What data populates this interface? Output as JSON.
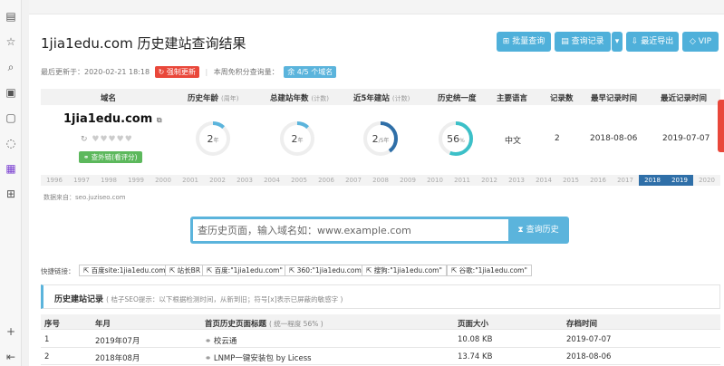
{
  "title": "1jia1edu.com 历史建站查询结果",
  "toolbar": {
    "batch": "批量查询",
    "records": "查询记录",
    "export": "最近导出",
    "vip": "VIP"
  },
  "meta": {
    "updated_prefix": "最后更新于：",
    "updated_time": "2020-02-21 18:18",
    "force_update": "强制更新",
    "weekly_prefix": "本周免积分查询量：",
    "weekly_badge": "余 4/5 个域名"
  },
  "columns": {
    "domain": "域名",
    "age": "历史年龄",
    "age_unit": "(周年)",
    "total": "总建站年数",
    "total_unit": "(计数)",
    "recent": "近5年建站",
    "recent_unit": "(计数)",
    "unity": "历史统一度",
    "lang": "主要语言",
    "count": "记录数",
    "earliest": "最早记录时间",
    "latest": "最近记录时间"
  },
  "summary": {
    "domain": "1jia1edu.com",
    "hearts": "♥♥♥♥♥",
    "outlink": "查外链(看评分)",
    "age_value": "2",
    "age_unit": "年",
    "age_fraction": 0.12,
    "total_value": "2",
    "total_unit": "年",
    "total_fraction": 0.12,
    "recent_value": "2",
    "recent_unit": "/5年",
    "recent_fraction": 0.4,
    "unity_value": "56",
    "unity_unit": "%",
    "unity_fraction": 0.56,
    "lang": "中文",
    "count": "2",
    "earliest": "2018-08-06",
    "latest": "2019-07-07"
  },
  "colors": {
    "ring_light": "#5bb4dc",
    "ring_dark": "#2f6fa8",
    "ring_teal": "#3cc0c8",
    "ring_track": "#eeeeee"
  },
  "years": [
    "1996",
    "1997",
    "1998",
    "1999",
    "2000",
    "2001",
    "2002",
    "2003",
    "2004",
    "2005",
    "2006",
    "2007",
    "2008",
    "2009",
    "2010",
    "2011",
    "2012",
    "2013",
    "2014",
    "2015",
    "2016",
    "2017",
    "2018",
    "2019",
    "2020"
  ],
  "years_active": [
    "2018",
    "2019"
  ],
  "source": "数据来自：seo.juziseo.com",
  "search": {
    "placeholder": "查历史页面，输入域名如：www.example.com",
    "button": "查询历史"
  },
  "quick": {
    "label": "快捷链接：",
    "links": [
      "百度site:1jia1edu.com",
      "站长BR",
      "百度:\"1jia1edu.com\"",
      "360:\"1jia1edu.com\"",
      "搜狗:\"1jia1edu.com\"",
      "谷歌:\"1jia1edu.com\""
    ]
  },
  "records_section": {
    "title": "历史建站记录",
    "hint": "( 桔子SEO提示：以下根据检测时间，从新到旧；符号[x]表示已屏蔽的敏感字 )"
  },
  "records_table": {
    "headers": [
      "序号",
      "年月",
      "首页历史页面标题",
      "页面大小",
      "存档时间"
    ],
    "title_hint": "( 统一程度 56% )",
    "rows": [
      [
        "1",
        "2019年07月",
        "校云通",
        "10.08 KB",
        "2019-07-07"
      ],
      [
        "2",
        "2018年08月",
        "LNMP一键安装包 by Licess",
        "13.74 KB",
        "2018-08-06"
      ]
    ]
  }
}
